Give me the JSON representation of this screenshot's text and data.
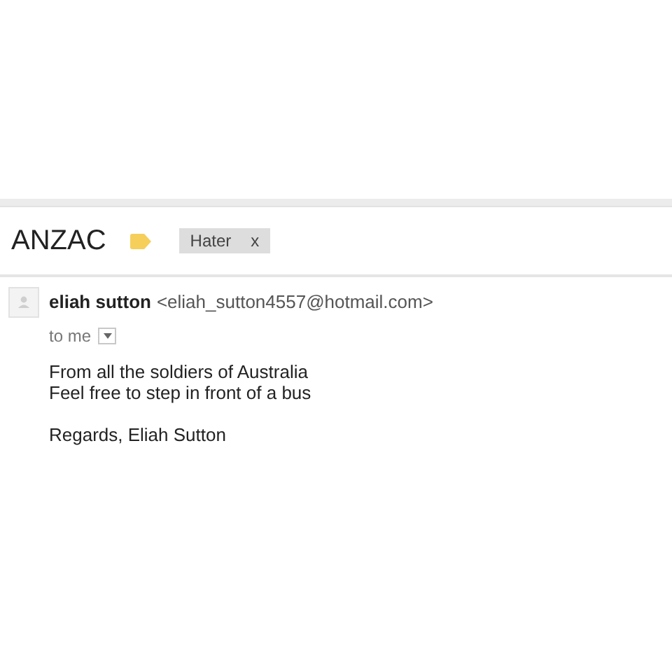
{
  "subject": "ANZAC",
  "label_tag": {
    "text": "Hater",
    "remove": "x"
  },
  "sender": {
    "name": "eliah sutton",
    "email": "<eliah_sutton4557@hotmail.com>"
  },
  "recipient": "to me",
  "body": [
    "From all the soldiers of Australia",
    "Feel free to step in front of a bus"
  ],
  "signature": "Regards, Eliah Sutton"
}
